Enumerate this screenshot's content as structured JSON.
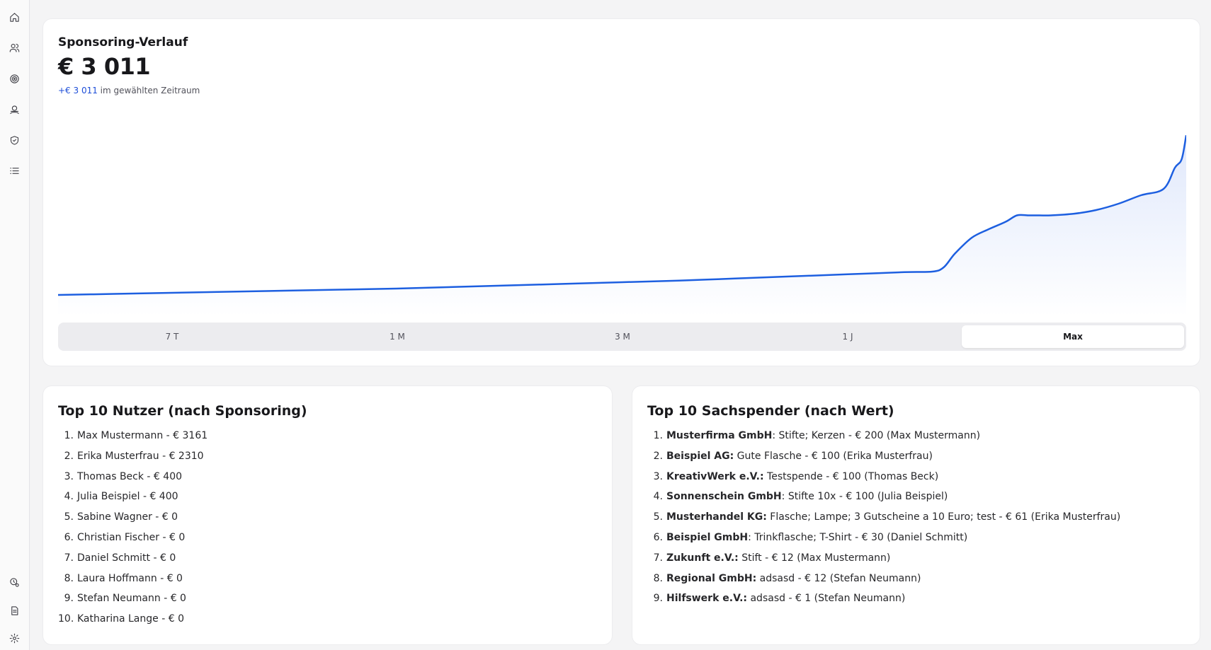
{
  "sidebar": {
    "icons": [
      "home-icon",
      "users-icon",
      "target-icon",
      "donate-icon",
      "shield-icon",
      "list-icon",
      "badge-icon",
      "document-icon",
      "settings-icon"
    ]
  },
  "sponsoring": {
    "title": "Sponsoring-Verlauf",
    "total": "€ 3 011",
    "delta": "+€ 3 011",
    "delta_suffix": " im gewählten Zeitraum",
    "ranges": [
      "7 T",
      "1 M",
      "3 M",
      "1 J",
      "Max"
    ],
    "active_range": "Max",
    "accent_color": "#1d5fe0"
  },
  "chart_data": {
    "type": "area",
    "title": "Sponsoring-Verlauf",
    "x": [
      0,
      5,
      10,
      15,
      20,
      25,
      30,
      35,
      40,
      45,
      50,
      55,
      60,
      65,
      70,
      75,
      77.5,
      78.5,
      79.5,
      81,
      82.5,
      84,
      85,
      86,
      87,
      88,
      90,
      92,
      94,
      96,
      98,
      99,
      99.6,
      100
    ],
    "values": [
      0,
      20,
      40,
      60,
      80,
      100,
      120,
      150,
      180,
      210,
      240,
      270,
      310,
      350,
      390,
      430,
      440,
      520,
      780,
      1080,
      1240,
      1380,
      1500,
      1500,
      1500,
      1500,
      1530,
      1600,
      1720,
      1880,
      2000,
      2400,
      2560,
      3011
    ],
    "ylim": [
      -400,
      3200
    ],
    "grid": false,
    "legend": "none"
  },
  "top_users": {
    "title": "Top 10 Nutzer (nach Sponsoring)",
    "items": [
      {
        "num": "1.",
        "text": "Max Mustermann - € 3161"
      },
      {
        "num": "2.",
        "text": "Erika Musterfrau - € 2310"
      },
      {
        "num": "3.",
        "text": "Thomas Beck - € 400"
      },
      {
        "num": "4.",
        "text": "Julia Beispiel - € 400"
      },
      {
        "num": "5.",
        "text": "Sabine Wagner - € 0"
      },
      {
        "num": "6.",
        "text": "Christian Fischer - € 0"
      },
      {
        "num": "7.",
        "text": "Daniel Schmitt - € 0"
      },
      {
        "num": "8.",
        "text": "Laura Hoffmann - € 0"
      },
      {
        "num": "9.",
        "text": "Stefan Neumann - € 0"
      },
      {
        "num": "10.",
        "text": "Katharina Lange - € 0"
      }
    ]
  },
  "top_donors": {
    "title": "Top 10 Sachspender (nach Wert)",
    "items": [
      {
        "num": "1.",
        "name": "Musterfirma GmbH",
        "sep": ":",
        "detail": " Stifte; Kerzen - € 200 (Max Mustermann)"
      },
      {
        "num": "2.",
        "name": "Beispiel AG:",
        "sep": "",
        "detail": " Gute Flasche - € 100 (Erika Musterfrau)"
      },
      {
        "num": "3.",
        "name": "KreativWerk e.V.:",
        "sep": "",
        "detail": " Testspende - € 100 (Thomas Beck)"
      },
      {
        "num": "4.",
        "name": "Sonnenschein GmbH",
        "sep": ":",
        "detail": " Stifte 10x - € 100 (Julia Beispiel)"
      },
      {
        "num": "5.",
        "name": "Musterhandel KG:",
        "sep": "",
        "detail": " Flasche; Lampe; 3 Gutscheine a 10 Euro; test - € 61 (Erika Musterfrau)"
      },
      {
        "num": "6.",
        "name": "Beispiel GmbH",
        "sep": ":",
        "detail": " Trinkflasche; T-Shirt - € 30 (Daniel Schmitt)"
      },
      {
        "num": "7.",
        "name": "Zukunft e.V.:",
        "sep": "",
        "detail": " Stift - € 12 (Max Mustermann)"
      },
      {
        "num": "8.",
        "name": "Regional GmbH:",
        "sep": "",
        "detail": " adsasd - € 12 (Stefan Neumann)"
      },
      {
        "num": "9.",
        "name": "Hilfswerk e.V.:",
        "sep": "",
        "detail": " adsasd - € 1 (Stefan Neumann)"
      }
    ]
  }
}
